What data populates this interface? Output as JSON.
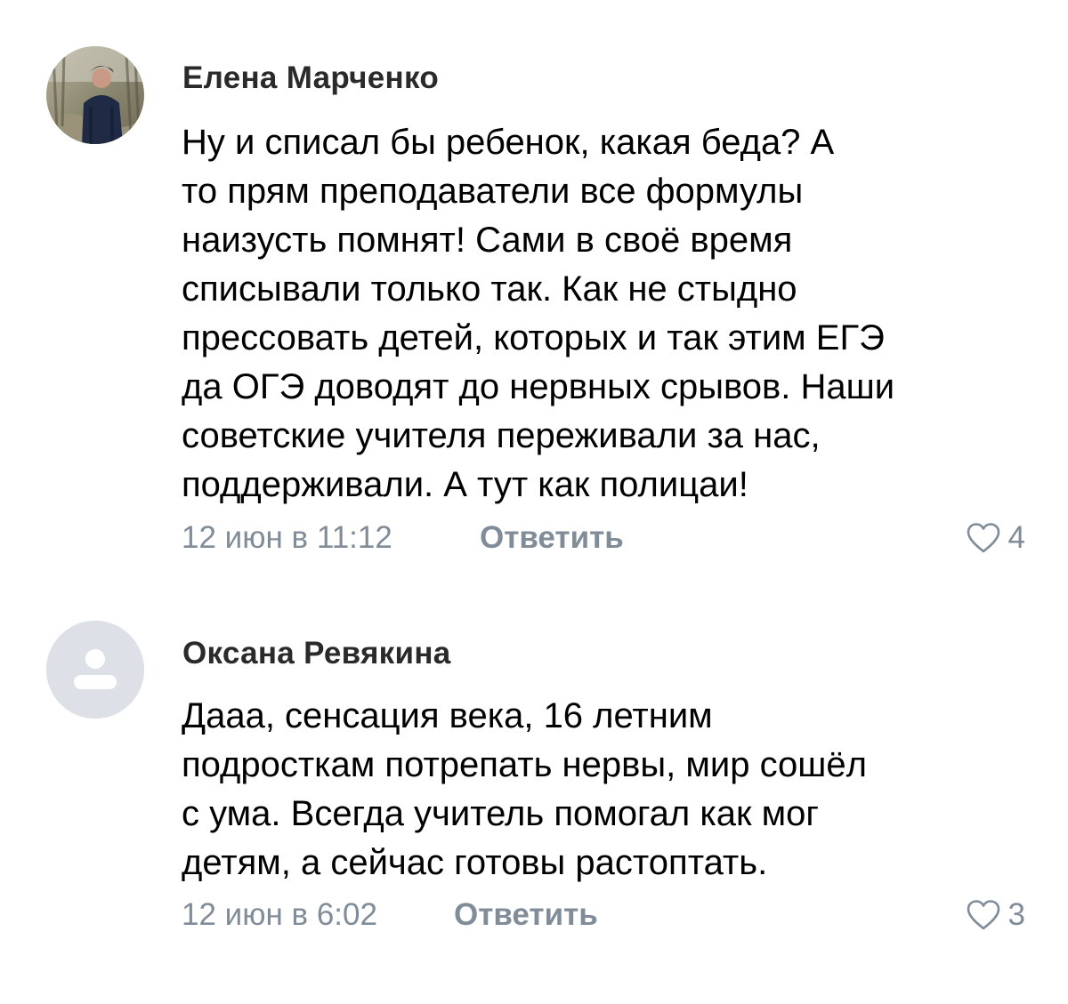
{
  "comments": [
    {
      "author": "Елена Марченко",
      "avatar": "user-photo",
      "text_lines": [
        "Ну и списал бы ребенок, какая беда? А",
        "то прям преподаватели все формулы",
        "наизусть помнят! Сами в своё время",
        "списывали только так. Как не стыдно",
        "прессовать детей, которых и так этим ЕГЭ",
        "да ОГЭ доводят до нервных срывов. Наши",
        "советские учителя переживали за нас,",
        "поддерживали. А тут как полицаи!"
      ],
      "timestamp": "12 июн в 11:12",
      "reply_label": "Ответить",
      "like_icon": "heart-outline-icon",
      "likes": "4"
    },
    {
      "author": "Оксана Ревякина",
      "avatar": "default-user-placeholder",
      "text_lines": [
        "Дааа, сенсация века, 16 летним",
        "подросткам потрепать нервы, мир сошёл",
        "с ума. Всегда учитель помогал как мог",
        "детям, а сейчас готовы растоптать."
      ],
      "timestamp": "12 июн в 6:02",
      "reply_label": "Ответить",
      "like_icon": "heart-outline-icon",
      "likes": "3"
    }
  ],
  "colors": {
    "text": "#000000",
    "author": "#2a2a2a",
    "meta": "#818c99",
    "avatar_placeholder_bg": "#dde1e7",
    "avatar_placeholder_fg": "#ffffff"
  }
}
